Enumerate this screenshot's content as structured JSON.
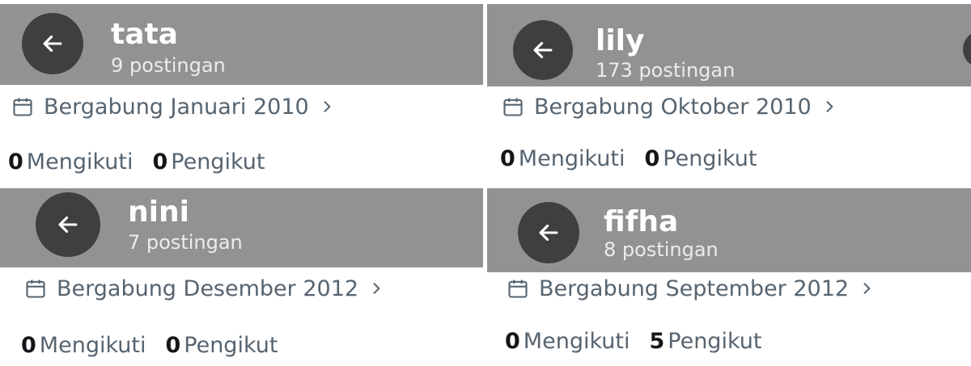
{
  "profiles": [
    {
      "name": "tata",
      "posts": "9 postingan",
      "joined": "Bergabung Januari 2010",
      "following_count": "0",
      "following_label": "Mengikuti",
      "followers_count": "0",
      "followers_label": "Pengikut"
    },
    {
      "name": "lily",
      "posts": "173 postingan",
      "joined": "Bergabung Oktober 2010",
      "following_count": "0",
      "following_label": "Mengikuti",
      "followers_count": "0",
      "followers_label": "Pengikut"
    },
    {
      "name": "nini",
      "posts": "7 postingan",
      "joined": "Bergabung Desember 2012",
      "following_count": "0",
      "following_label": "Mengikuti",
      "followers_count": "0",
      "followers_label": "Pengikut"
    },
    {
      "name": "fifha",
      "posts": "8 postingan",
      "joined": "Bergabung September 2012",
      "following_count": "0",
      "following_label": "Mengikuti",
      "followers_count": "5",
      "followers_label": "Pengikut"
    }
  ],
  "icons": {
    "back": "arrow-left-icon",
    "calendar": "calendar-icon",
    "chevron": "chevron-right-icon"
  },
  "colors": {
    "header_bg": "#929292",
    "back_button": "#3f3f3f",
    "secondary_text": "#566470",
    "primary_text": "#14171a"
  }
}
